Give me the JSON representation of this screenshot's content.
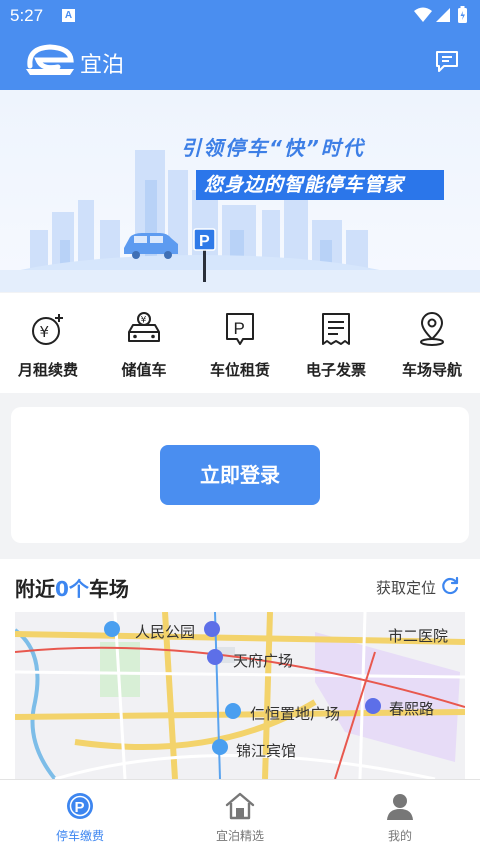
{
  "status_bar": {
    "time": "5:27",
    "notification_icon": "a-letter-icon",
    "icons": [
      "wifi-icon",
      "signal-icon",
      "battery-icon"
    ]
  },
  "app_bar": {
    "title": "宜泊",
    "logo_icon": "app-logo-icon",
    "message_icon": "message-icon"
  },
  "banner": {
    "slogan_line1": "引领停车“快”时代",
    "slogan_line2": "您身边的智能停车管家"
  },
  "shortcuts": [
    {
      "label": "月租续费",
      "icon": "yuan-coin-icon"
    },
    {
      "label": "储值车",
      "icon": "stored-value-car-icon"
    },
    {
      "label": "车位租赁",
      "icon": "parking-rent-icon"
    },
    {
      "label": "电子发票",
      "icon": "invoice-icon"
    },
    {
      "label": "车场导航",
      "icon": "location-pin-icon"
    }
  ],
  "login": {
    "button_label": "立即登录"
  },
  "nearby": {
    "title_prefix": "附近",
    "count": "0个",
    "title_suffix": "车场",
    "locate_label": "获取定位",
    "map_labels": [
      "人民公园",
      "天府广场",
      "仁恒置地广场",
      "锦江宾馆",
      "春熙路",
      "市二医院"
    ]
  },
  "tabbar": [
    {
      "label": "停车缴费",
      "icon": "parking-pay-icon",
      "active": true
    },
    {
      "label": "宜泊精选",
      "icon": "home-store-icon",
      "active": false
    },
    {
      "label": "我的",
      "icon": "user-icon",
      "active": false
    }
  ],
  "colors": {
    "primary": "#4a8ef0",
    "accent_text": "#3d86f0",
    "background": "#f2f3f5"
  }
}
